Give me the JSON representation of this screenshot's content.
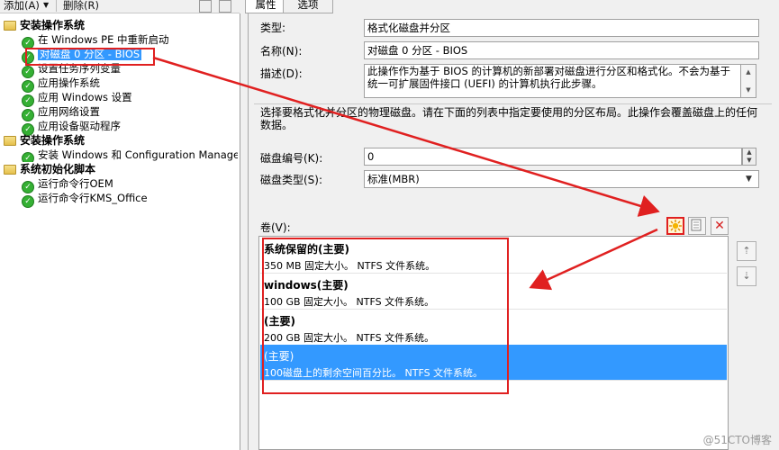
{
  "left_toolbar": {
    "add_label": "添加(A)",
    "delete_label": "删除(R)"
  },
  "tree": {
    "groups": [
      {
        "label": "安装操作系统"
      },
      {
        "label": "安装操作系统"
      },
      {
        "label": "系统初始化脚本"
      }
    ],
    "items": [
      "在 Windows PE 中重新启动",
      "对磁盘 0 分区 - BIOS",
      "设置任务序列变量",
      "应用操作系统",
      "应用 Windows 设置",
      "应用网络设置",
      "应用设备驱动程序",
      "安装 Windows 和 Configuration Manager",
      "运行命令行OEM",
      "运行命令行KMS_Office"
    ]
  },
  "tabs": {
    "properties": "属性",
    "options": "选项"
  },
  "form": {
    "type_label": "类型:",
    "type_value": "格式化磁盘并分区",
    "name_label": "名称(N):",
    "name_value": "对磁盘 0 分区 - BIOS",
    "desc_label": "描述(D):",
    "desc_value": "此操作作为基于 BIOS 的计算机的新部署对磁盘进行分区和格式化。不会为基于统一可扩展固件接口 (UEFI) 的计算机执行此步骤。",
    "disk_desc": "选择要格式化并分区的物理磁盘。请在下面的列表中指定要使用的分区布局。此操作会覆盖磁盘上的任何数据。",
    "disk_number_label": "磁盘编号(K):",
    "disk_number_value": "0",
    "disk_type_label": "磁盘类型(S):",
    "disk_type_value": "标准(MBR)",
    "volume_label": "卷(V):"
  },
  "volumes": [
    {
      "name": "系统保留的(主要)",
      "desc": "350 MB 固定大小。 NTFS 文件系统。"
    },
    {
      "name": "windows(主要)",
      "desc": "100 GB 固定大小。 NTFS 文件系统。"
    },
    {
      "name": "(主要)",
      "desc": "200 GB 固定大小。 NTFS 文件系统。"
    },
    {
      "name": "(主要)",
      "desc": "100磁盘上的剩余空间百分比。 NTFS 文件系统。"
    }
  ],
  "watermark": "@51CTO博客",
  "colors": {
    "selection": "#3399ff",
    "highlight": "#e02020",
    "check": "#35b034"
  }
}
